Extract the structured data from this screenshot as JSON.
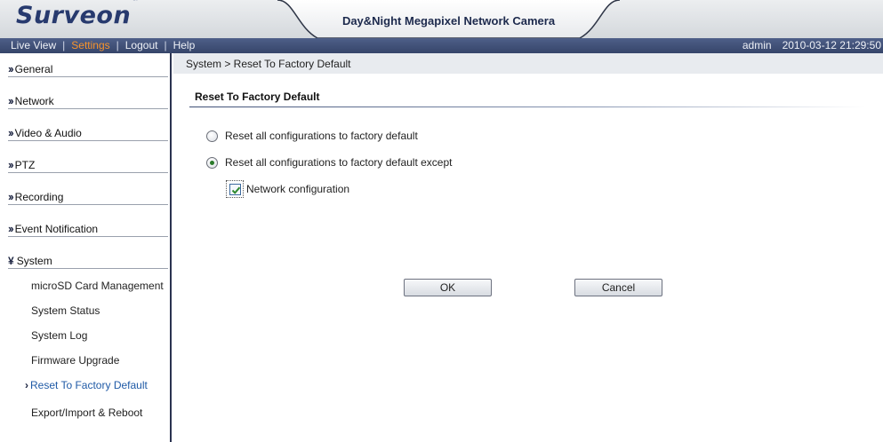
{
  "header": {
    "logo": "Surveon",
    "trademark": "™",
    "title": "Day&Night Megapixel Network Camera"
  },
  "navbar": {
    "links": [
      "Live View",
      "Settings",
      "Logout",
      "Help"
    ],
    "active": "Settings",
    "user": "admin",
    "datetime": "2010-03-12 21:29:50"
  },
  "sidebar": {
    "sections": [
      "General",
      "Network",
      "Video & Audio",
      "PTZ",
      "Recording",
      "Event Notification",
      "System"
    ],
    "system_items": [
      "microSD Card Management",
      "System Status",
      "System Log",
      "Firmware Upgrade",
      "Reset To Factory Default",
      "Export/Import & Reboot"
    ],
    "current_item": "Reset To Factory Default"
  },
  "content": {
    "breadcrumb": "System > Reset To Factory Default",
    "section_title": "Reset To Factory Default",
    "option_all": "Reset all configurations to factory default",
    "option_except": "Reset all configurations to factory default except",
    "selected_option": "option_except",
    "network_config_label": "Network configuration",
    "network_config_checked": true,
    "ok_label": "OK",
    "cancel_label": "Cancel"
  },
  "colors": {
    "navbar": "#3e4d74",
    "active_link": "#f7942d",
    "logo": "#273a6e",
    "current_item": "#1f5aa6"
  }
}
